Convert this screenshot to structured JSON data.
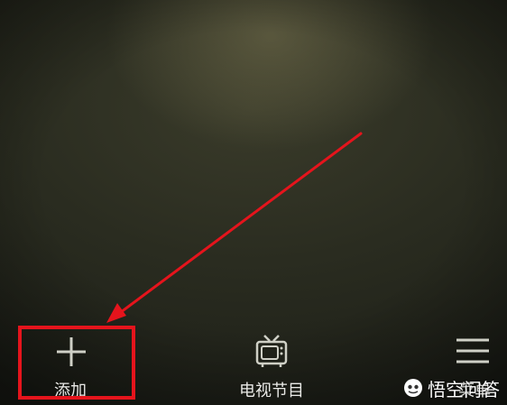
{
  "bottom_nav": {
    "items": [
      {
        "label": "添加",
        "icon": "plus-icon"
      },
      {
        "label": "电视节目",
        "icon": "tv-icon"
      },
      {
        "label": "菜单",
        "icon": "menu-icon"
      }
    ]
  },
  "annotation": {
    "arrow_color": "#e5141c",
    "highlight_color": "#e5141c"
  },
  "watermark": {
    "text": "悟空问答",
    "icon": "wukong-logo-icon"
  }
}
